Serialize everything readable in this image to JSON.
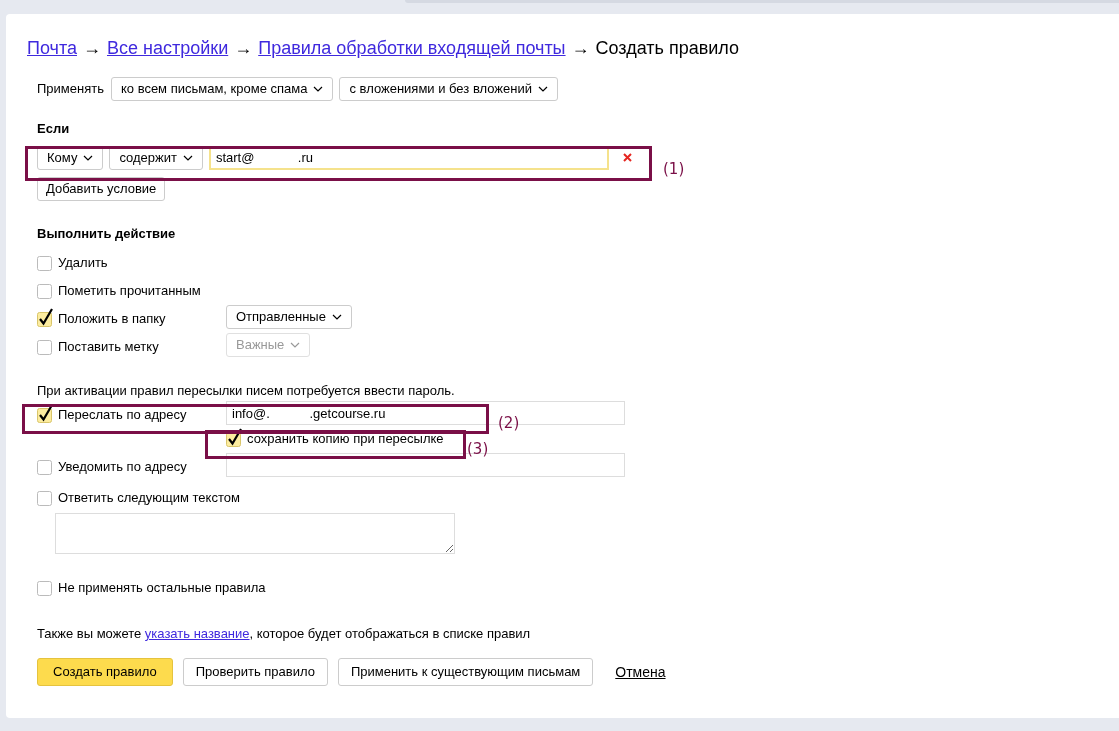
{
  "breadcrumb": [
    {
      "kind": "link",
      "text": "Почта"
    },
    {
      "kind": "separator",
      "text": "→"
    },
    {
      "kind": "link",
      "text": "Все настройки"
    },
    {
      "kind": "separator",
      "text": "→"
    },
    {
      "kind": "link",
      "text": "Правила обработки входящей почты"
    },
    {
      "kind": "separator",
      "text": "→"
    },
    {
      "kind": "current",
      "text": "Создать правило"
    }
  ],
  "apply": {
    "label": "Применять",
    "selects": [
      "ко всем письмам, кроме спама",
      "с вложениями и без вложений"
    ]
  },
  "conditions": {
    "heading": "Если",
    "rows": [
      {
        "field": "Кому",
        "operator": "содержит",
        "value": "start@            .ru"
      }
    ],
    "add_button": "Добавить условие"
  },
  "actions": {
    "heading": "Выполнить действие",
    "items": [
      {
        "label": "Удалить",
        "checked": false
      },
      {
        "label": "Пометить прочитанным",
        "checked": false
      },
      {
        "label": "Положить в папку",
        "checked": true,
        "select": {
          "value": "Отправленные",
          "disabled": false
        }
      },
      {
        "label": "Поставить метку",
        "checked": false,
        "select": {
          "value": "Важные",
          "disabled": true
        }
      }
    ]
  },
  "password_note": "При активации правил пересылки писем потребуется ввести пароль.",
  "forward": {
    "label": "Переслать по адресу",
    "checked": true,
    "value": "info@.           .getcourse.ru",
    "save_copy": {
      "label": "сохранить копию при пересылке",
      "checked": true
    }
  },
  "notify": {
    "label": "Уведомить по адресу",
    "checked": false
  },
  "reply": {
    "label": "Ответить следующим текстом",
    "checked": false
  },
  "stop": {
    "label": "Не применять остальные правила",
    "checked": false
  },
  "footer_note": {
    "before": "Также вы можете ",
    "link": "указать название",
    "after": ", которое будет отображаться в списке правил"
  },
  "buttons": [
    {
      "kind": "primary",
      "label": "Создать правило"
    },
    {
      "kind": "default",
      "label": "Проверить правило"
    },
    {
      "kind": "default",
      "label": "Применить к существующим письмам"
    },
    {
      "kind": "link",
      "label": "Отмена"
    }
  ],
  "annotations": [
    {
      "label": "(1)"
    },
    {
      "label": "(2)"
    },
    {
      "label": "(3)"
    }
  ]
}
